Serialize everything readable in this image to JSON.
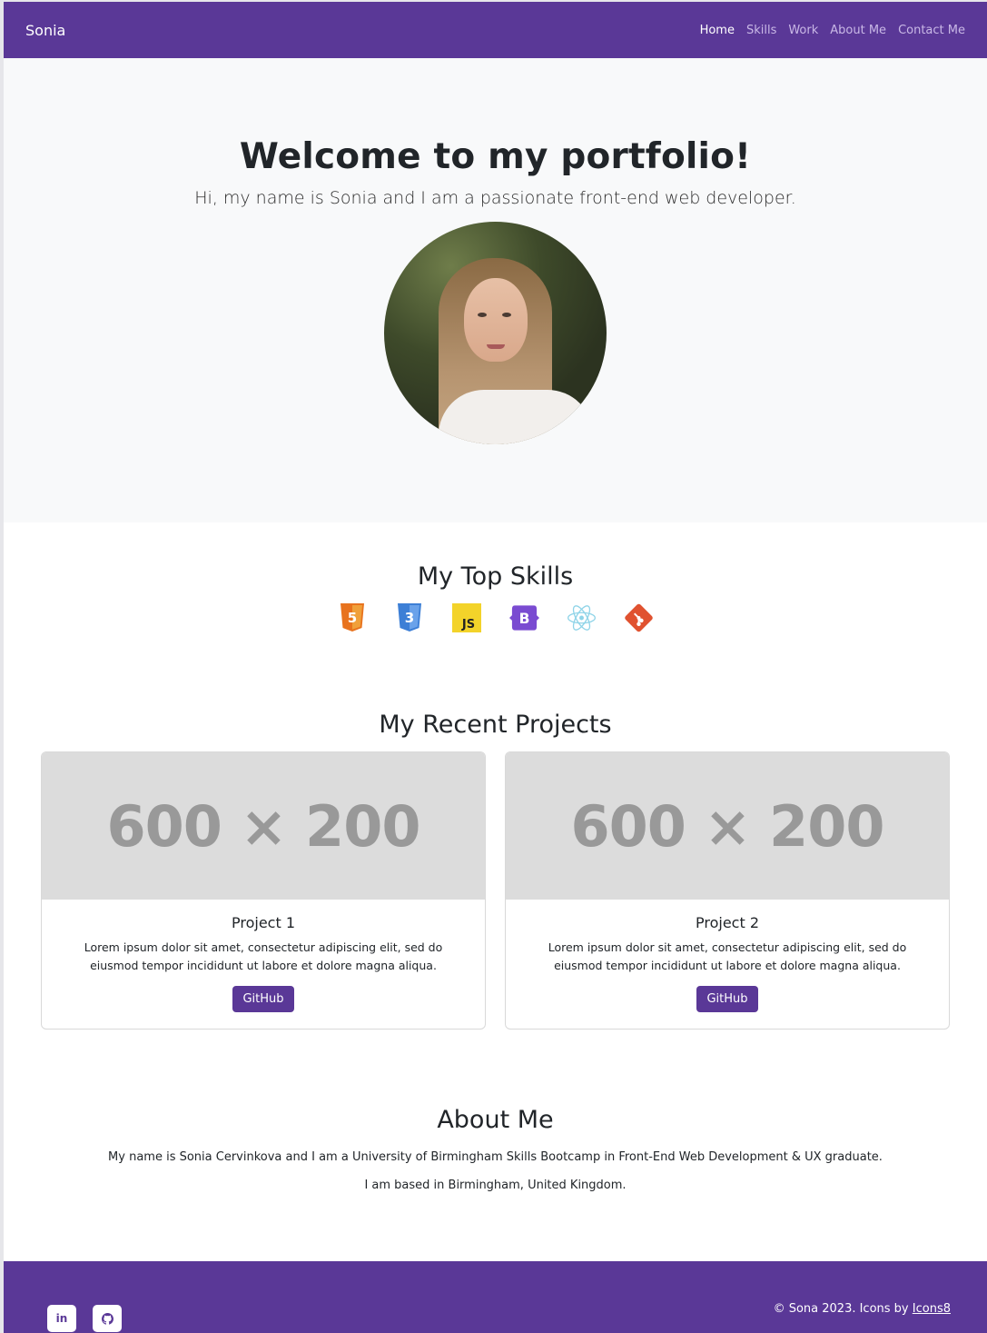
{
  "navbar": {
    "brand": "Sonia",
    "links": [
      "Home",
      "Skills",
      "Work",
      "About Me",
      "Contact Me"
    ],
    "active": "Home"
  },
  "hero": {
    "title": "Welcome to my portfolio!",
    "lead": "Hi, my name is Sonia and I am a passionate front-end web developer."
  },
  "skills": {
    "title": "My Top Skills",
    "icons": [
      "html5-icon",
      "css3-icon",
      "javascript-icon",
      "bootstrap-icon",
      "react-icon",
      "git-icon"
    ]
  },
  "projects": {
    "title": "My Recent Projects",
    "items": [
      {
        "placeholder": "600 × 200",
        "title": "Project 1",
        "description": "Lorem ipsum dolor sit amet, consectetur adipiscing elit, sed do eiusmod tempor incididunt ut labore et dolore magna aliqua.",
        "button": "GitHub"
      },
      {
        "placeholder": "600 × 200",
        "title": "Project 2",
        "description": "Lorem ipsum dolor sit amet, consectetur adipiscing elit, sed do eiusmod tempor incididunt ut labore et dolore magna aliqua.",
        "button": "GitHub"
      }
    ]
  },
  "about": {
    "title": "About Me",
    "paragraphs": [
      "My name is Sonia Cervinkova and I am a University of Birmingham Skills Bootcamp in Front-End Web Development & UX graduate.",
      "I am based in Birmingham, United Kingdom."
    ]
  },
  "footer": {
    "social": [
      "linkedin-icon",
      "github-icon"
    ],
    "linkedin_label": "in",
    "copyright": "© Sona 2023. Icons by",
    "icons_link": "Icons8"
  },
  "colors": {
    "primary": "#5a3897",
    "hero_bg": "#f8f9fa",
    "placeholder_bg": "#dcdcdc",
    "placeholder_text": "#999999"
  }
}
